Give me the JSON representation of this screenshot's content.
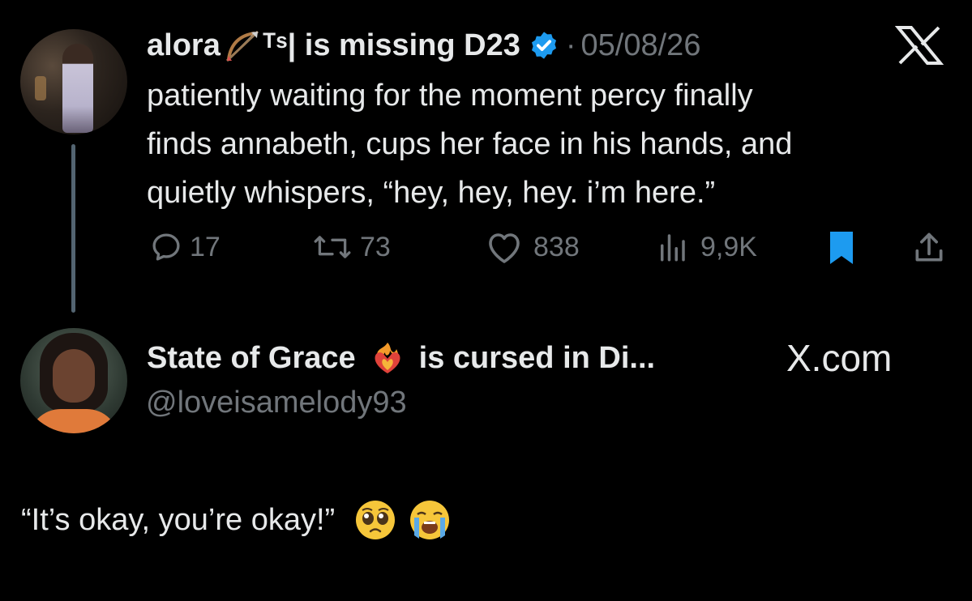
{
  "tweet": {
    "author": "alora",
    "author_suffix": "ᵀˢ| is missing D23",
    "separator": "·",
    "date": "05/08/26",
    "text_line1": "patiently waiting for the moment percy finally",
    "text_line2": "finds annabeth, cups her face in his hands, and",
    "text_line3": "quietly whispers, “hey, hey, hey. i’m here.”",
    "replies": "17",
    "reposts": "73",
    "likes": "838",
    "views": "9,9K",
    "x_logo": "X"
  },
  "quote": {
    "name_part1": "State of Grace",
    "name_part2": "is cursed in Di...",
    "handle": "@loveisamelody93",
    "site": "X.com",
    "text": "“It’s okay, you’re okay!”"
  },
  "colors": {
    "background": "#000000",
    "text": "#e7e9ea",
    "muted": "#71767b",
    "verified": "#1d9bf0",
    "bookmark": "#1d9bf0"
  },
  "icons": [
    "bow-and-arrow-icon",
    "verified-badge-icon",
    "x-logo-icon",
    "reply-icon",
    "repost-icon",
    "like-icon",
    "views-icon",
    "bookmark-icon",
    "share-icon",
    "heart-on-fire-icon",
    "pleading-face-icon",
    "crying-face-icon"
  ]
}
